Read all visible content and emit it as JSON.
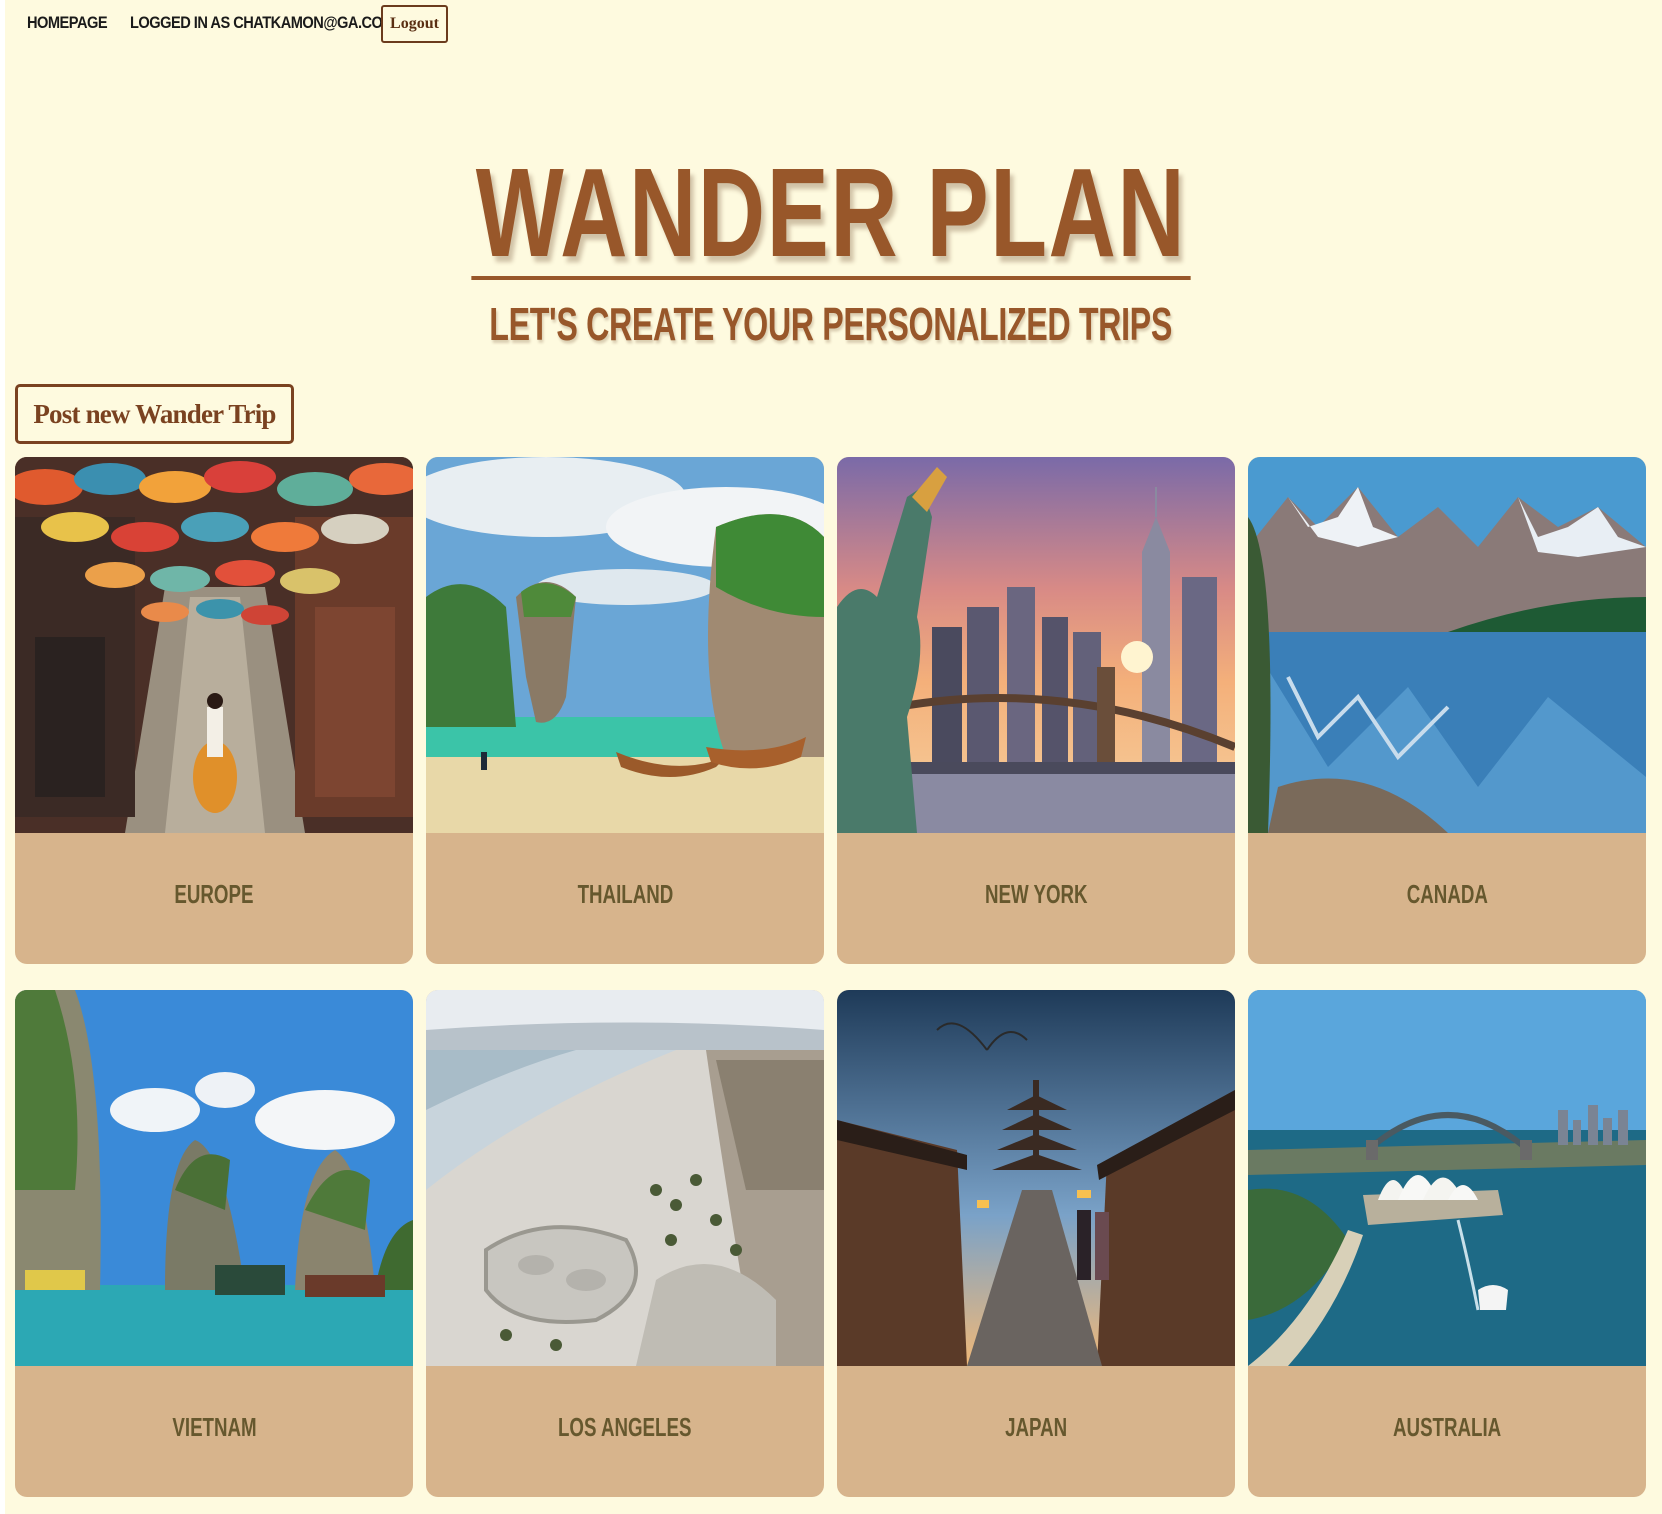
{
  "nav": {
    "home_label": "HOMEPAGE",
    "user_label": "LOGGED IN AS CHATKAMON@GA.CO",
    "logout_label": "Logout"
  },
  "hero": {
    "title": "WANDER PLAN",
    "subtitle": "LET'S CREATE YOUR PERSONALIZED TRIPS"
  },
  "actions": {
    "post_trip_label": "Post new Wander Trip"
  },
  "destinations": [
    {
      "label": "EUROPE",
      "image": "colorful-umbrella-street-photo"
    },
    {
      "label": "THAILAND",
      "image": "limestone-island-longtail-boats-photo"
    },
    {
      "label": "NEW YORK",
      "image": "statue-of-liberty-skyline-photo"
    },
    {
      "label": "CANADA",
      "image": "mountain-lake-reflection-photo"
    },
    {
      "label": "VIETNAM",
      "image": "halong-bay-floating-village-photo"
    },
    {
      "label": "LOS ANGELES",
      "image": "venice-beach-skatepark-aerial-photo"
    },
    {
      "label": "JAPAN",
      "image": "kyoto-pagoda-street-photo"
    },
    {
      "label": "AUSTRALIA",
      "image": "sydney-opera-house-harbour-photo"
    }
  ],
  "colors": {
    "background": "#fefadf",
    "accent_brown": "#98572a",
    "card_background": "#d7b48c",
    "card_label": "#66582e"
  }
}
